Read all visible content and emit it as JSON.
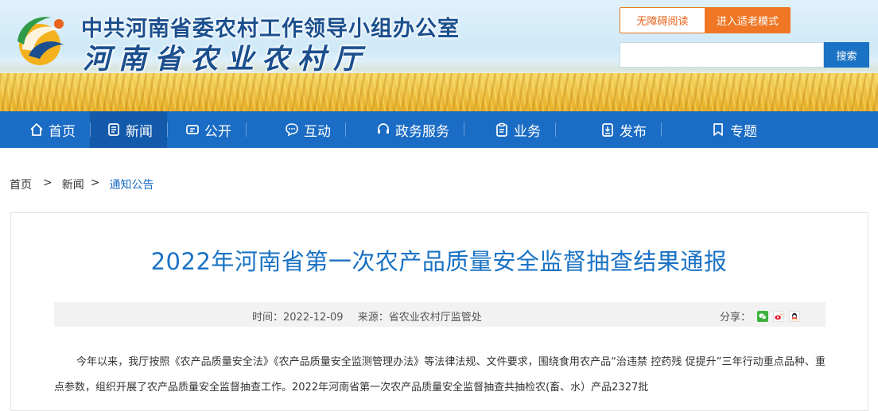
{
  "header": {
    "org_line": "中共河南省委农村工作领导小组办公室",
    "dept_name": "河南省农业农村厅",
    "accessibility_label": "无障碍阅读",
    "elder_mode_label": "进入适老模式",
    "search_placeholder": "",
    "search_label": "搜索"
  },
  "nav": {
    "items": [
      {
        "label": "首页",
        "icon": "home-icon"
      },
      {
        "label": "新闻",
        "icon": "news-icon"
      },
      {
        "label": "公开",
        "icon": "open-icon"
      },
      {
        "label": "互动",
        "icon": "chat-icon"
      },
      {
        "label": "政务服务",
        "icon": "service-icon"
      },
      {
        "label": "业务",
        "icon": "clipboard-icon"
      },
      {
        "label": "发布",
        "icon": "publish-icon"
      },
      {
        "label": "专题",
        "icon": "bookmark-icon"
      }
    ],
    "active_index": 1
  },
  "breadcrumb": {
    "home": "首页",
    "news": "新闻",
    "current": "通知公告",
    "separator": ">"
  },
  "article": {
    "title": "2022年河南省第一次农产品质量安全监督抽查结果通报",
    "time": "时间：2022-12-09",
    "source": "来源：省农业农村厅监管处",
    "share_label": "分享：",
    "paragraph": "今年以来，我厅按照《农产品质量安全法》《农产品质量安全监测管理办法》等法律法规、文件要求，围绕食用农产品“治违禁 控药残 促提升”三年行动重点品种、重点参数，组织开展了农产品质量安全监督抽查工作。2022年河南省第一次农产品质量安全监督抽查共抽检农(畜、水）产品2327批"
  },
  "colors": {
    "nav_bg": "#1a6cc4",
    "title_blue": "#1a72c4",
    "accent_orange": "#ee7624"
  }
}
